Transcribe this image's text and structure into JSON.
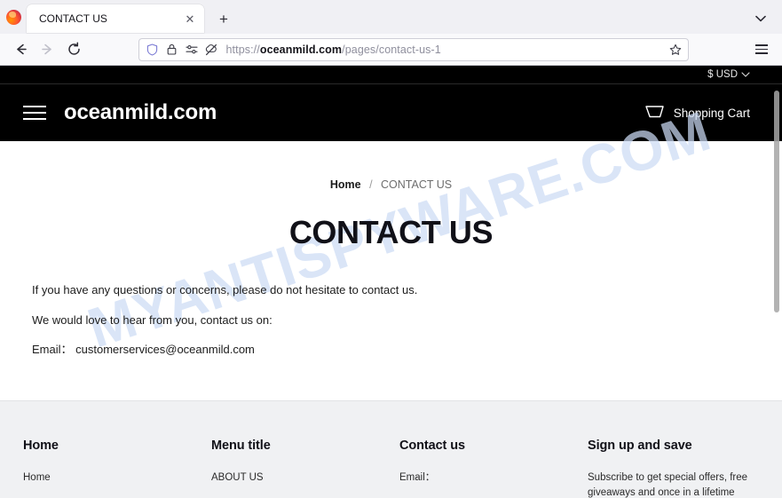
{
  "browser": {
    "tab": {
      "title": "CONTACT US",
      "close_label": "✕"
    },
    "new_tab_label": "+",
    "list_tabs_label": "⌄",
    "back_label": "←",
    "forward_label": "→",
    "reload_label": "↻",
    "url_prefix": "https://",
    "url_domain": "oceanmild.com",
    "url_path": "/pages/contact-us-1",
    "full_url": "https://oceanmild.com/pages/contact-us-1",
    "bookmark_label": "☆",
    "menu_label": "≡"
  },
  "site": {
    "topbar": {
      "currency": "$ USD",
      "chevron": "⌄"
    },
    "header": {
      "brand": "oceanmild.com",
      "cart_label": "Shopping Cart"
    },
    "watermark": "MYANTISPYWARE.COM",
    "breadcrumb": {
      "home": "Home",
      "separator": "/",
      "current": "CONTACT US"
    },
    "page_title": "CONTACT US",
    "paragraphs": [
      "If you have any questions or concerns, please do not hesitate to contact us.",
      "We would love to hear from you, contact us on:",
      "Email： customerservices@oceanmild.com"
    ],
    "footer": {
      "columns": [
        {
          "heading": "Home",
          "items": [
            "Home"
          ]
        },
        {
          "heading": "Menu title",
          "items": [
            "ABOUT US"
          ]
        },
        {
          "heading": "Contact us",
          "items": [
            "Email："
          ]
        },
        {
          "heading": "Sign up and save",
          "items": [
            "Subscribe to get special offers, free giveaways and once in a lifetime"
          ]
        }
      ]
    }
  },
  "colors": {
    "header_bg": "#000000",
    "page_bg": "#ffffff",
    "footer_bg": "#f0f1f3",
    "watermark": "#ccdcf5",
    "accent_text": "#111118"
  }
}
